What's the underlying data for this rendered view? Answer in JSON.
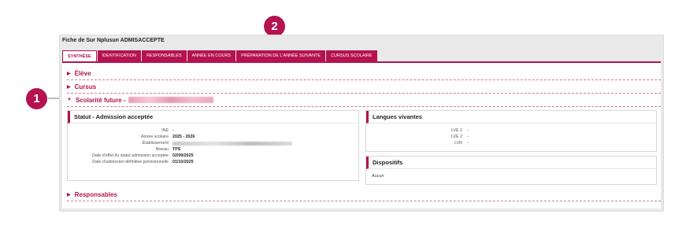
{
  "fiche": {
    "title": "Fiche de Sur Nplusun ADMISACCEPTE"
  },
  "tabs": [
    {
      "label": "SYNTHÈSE"
    },
    {
      "label": "IDENTIFICATION"
    },
    {
      "label": "RESPONSABLES"
    },
    {
      "label": "ANNÉE EN COURS"
    },
    {
      "label": "PRÉPARATION DE L'ANNÉE SUIVANTE"
    },
    {
      "label": "CURSUS SCOLAIRE"
    }
  ],
  "sections": {
    "eleve": "Élève",
    "cursus": "Cursus",
    "scolarite_future": "Scolarité future -",
    "responsables": "Responsables"
  },
  "statut_panel": {
    "title": "Statut - Admission acceptée",
    "rows": [
      {
        "label": "INE",
        "value": "-"
      },
      {
        "label": "Année scolaire",
        "value": "2025 - 2026"
      },
      {
        "label": "Établissement",
        "value": ""
      },
      {
        "label": "Niveau",
        "value": "TPS"
      },
      {
        "label": "Date d'effet du statut admission acceptée",
        "value": "02/09/2025"
      },
      {
        "label": "Date d'admission définitive prévisionnelle",
        "value": "01/10/2025"
      }
    ]
  },
  "langues_panel": {
    "title": "Langues vivantes",
    "rows": [
      {
        "label": "LVE 1",
        "value": "-"
      },
      {
        "label": "LVE 2",
        "value": "-"
      },
      {
        "label": "LVR",
        "value": "-"
      }
    ]
  },
  "dispositifs_panel": {
    "title": "Dispositifs",
    "value": "Aucun"
  },
  "callouts": {
    "one": "1",
    "two": "2"
  },
  "colors": {
    "accent": "#b5124f",
    "background": "#e9e9e9"
  },
  "icons": {
    "section_collapsed": "triangle-right-icon",
    "section_expanded": "triangle-down-icon"
  }
}
